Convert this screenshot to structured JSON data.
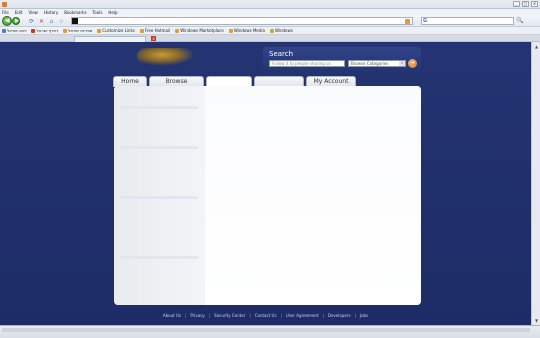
{
  "browser": {
    "menu": [
      "File",
      "Edit",
      "View",
      "History",
      "Bookmarks",
      "Tools",
      "Help"
    ],
    "bookmarks": [
      "יהוא ישראל",
      "דפדף ישראל",
      "ספריות ישראל",
      "Customize Links",
      "Free Hotmail",
      "Windows Marketplace",
      "Windows Media",
      "Windows"
    ],
    "window_buttons": [
      "_",
      "□",
      "✕"
    ],
    "tab_close": "x",
    "search_engine_glyph": "G",
    "search_button": "🔍"
  },
  "header": {
    "search": {
      "label": "Search",
      "placeholder": "Follow it to people sharing us",
      "category": "Browse Categories",
      "caret": "▾",
      "go_glyph": "➜"
    }
  },
  "nav": {
    "tabs": [
      "Home",
      "Browse",
      "",
      "",
      "My Account"
    ]
  },
  "footer": {
    "links": [
      "About Us",
      "Privacy",
      "Security Center",
      "Contact Us",
      "User Agreement",
      "Developers",
      "Jobs"
    ]
  },
  "colors": {
    "page_bg": "#1f2f6b",
    "content_bg": "#ffffff",
    "search_go": "#d9782a"
  }
}
